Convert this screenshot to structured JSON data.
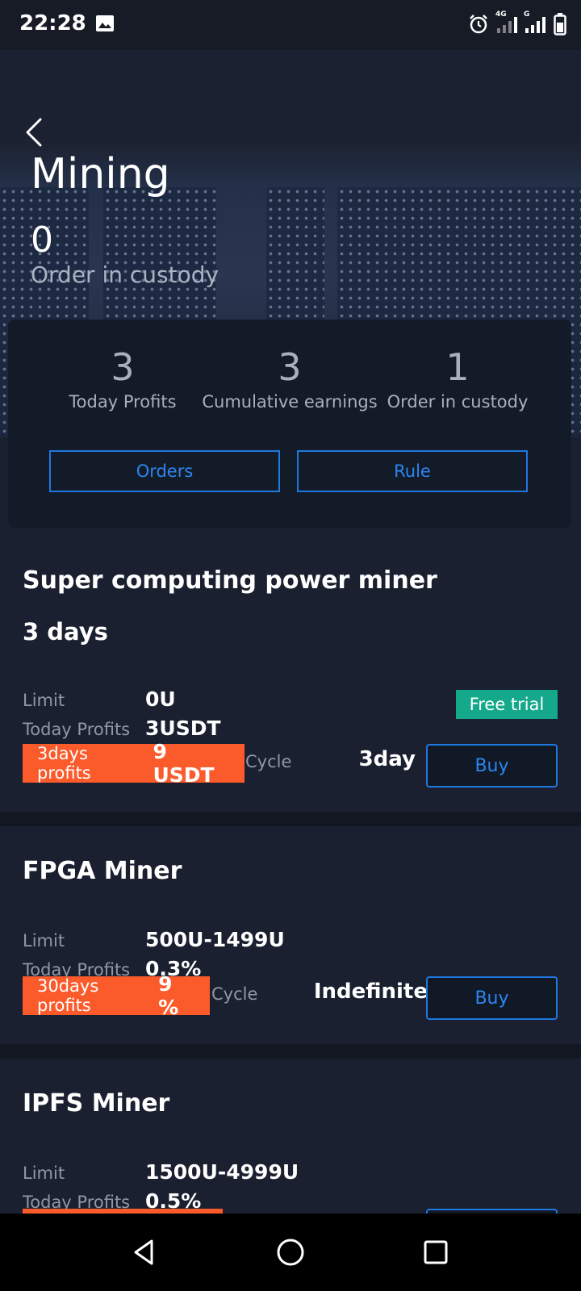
{
  "status_bar": {
    "time": "22:28",
    "network_1": "4G",
    "network_2": "G"
  },
  "header": {
    "title": "Mining",
    "custody_count": "0",
    "custody_label": "Order in custody"
  },
  "stats": [
    {
      "value": "3",
      "label": "Today Profits"
    },
    {
      "value": "3",
      "label": "Cumulative earnings"
    },
    {
      "value": "1",
      "label": "Order in custody"
    }
  ],
  "actions": {
    "orders": "Orders",
    "rule": "Rule"
  },
  "products": [
    {
      "title": "Super computing power miner",
      "subtitle": "3 days",
      "limit_label": "Limit",
      "limit_value": "0U",
      "profit_label": "Today Profits",
      "profit_value": "3USDT",
      "period_label": "3days profits",
      "period_value": "9 USDT",
      "cycle_label": "Cycle",
      "cycle_value": "3day",
      "badge": "Free trial",
      "buy": "Buy"
    },
    {
      "title": "FPGA Miner",
      "limit_label": "Limit",
      "limit_value": "500U-1499U",
      "profit_label": "Today Profits",
      "profit_value": "0.3%",
      "period_label": "30days profits",
      "period_value": "9 %",
      "cycle_label": "Cycle",
      "cycle_value": "Indefinite",
      "buy": "Buy"
    },
    {
      "title": "IPFS Miner",
      "limit_label": "Limit",
      "limit_value": "1500U-4999U",
      "profit_label": "Today Profits",
      "profit_value": "0.5%"
    }
  ],
  "colors": {
    "accent": "#1f78e0",
    "profit_box": "#fb5a2b",
    "badge": "#14a98b",
    "background": "#1a2030"
  }
}
